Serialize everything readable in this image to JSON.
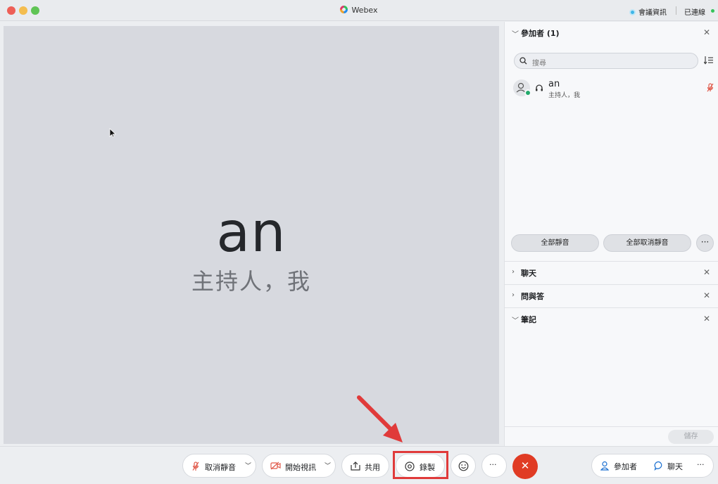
{
  "window": {
    "app_title": "Webex",
    "meeting_info": "會議資訊",
    "connection_status": "已連線",
    "connection_color": "#35c35a"
  },
  "stage": {
    "name": "an",
    "role": "主持人，我"
  },
  "panel": {
    "participants": {
      "title": "參加者 (1)",
      "search_placeholder": "搜尋",
      "list": [
        {
          "name": "an",
          "role": "主持人，我"
        }
      ],
      "mute_all": "全部靜音",
      "unmute_all": "全部取消靜音",
      "more": "···"
    },
    "sections": [
      {
        "title": "聊天",
        "expanded": false
      },
      {
        "title": "問與答",
        "expanded": false
      },
      {
        "title": "筆記",
        "expanded": true
      }
    ],
    "save_label": "儲存"
  },
  "controls": {
    "unmute": "取消靜音",
    "start_video": "開始視訊",
    "share": "共用",
    "record": "錄製",
    "more": "···",
    "participants": "參加者",
    "chat": "聊天",
    "end_color": "#e03b24"
  },
  "annotation": {
    "highlight_color": "#e03a3a"
  }
}
